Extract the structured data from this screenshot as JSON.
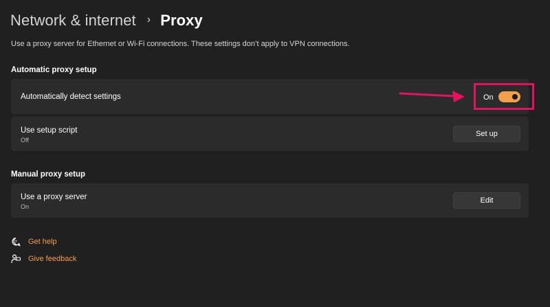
{
  "breadcrumb": {
    "parent": "Network & internet",
    "separator": "›",
    "current": "Proxy"
  },
  "description": "Use a proxy server for Ethernet or Wi-Fi connections. These settings don’t apply to VPN connections.",
  "automatic": {
    "title": "Automatic proxy setup",
    "detect": {
      "label": "Automatically detect settings",
      "toggle_text": "On",
      "toggle_state": true
    },
    "script": {
      "label": "Use setup script",
      "status": "Off",
      "button": "Set up"
    }
  },
  "manual": {
    "title": "Manual proxy setup",
    "proxy": {
      "label": "Use a proxy server",
      "status": "On",
      "button": "Edit"
    }
  },
  "links": [
    {
      "label": "Get help",
      "icon": "help-icon"
    },
    {
      "label": "Give feedback",
      "icon": "feedback-icon"
    }
  ],
  "colors": {
    "accent": "#f0a04b",
    "highlight": "#e5125f",
    "background": "#202020",
    "card": "#2b2b2b"
  }
}
